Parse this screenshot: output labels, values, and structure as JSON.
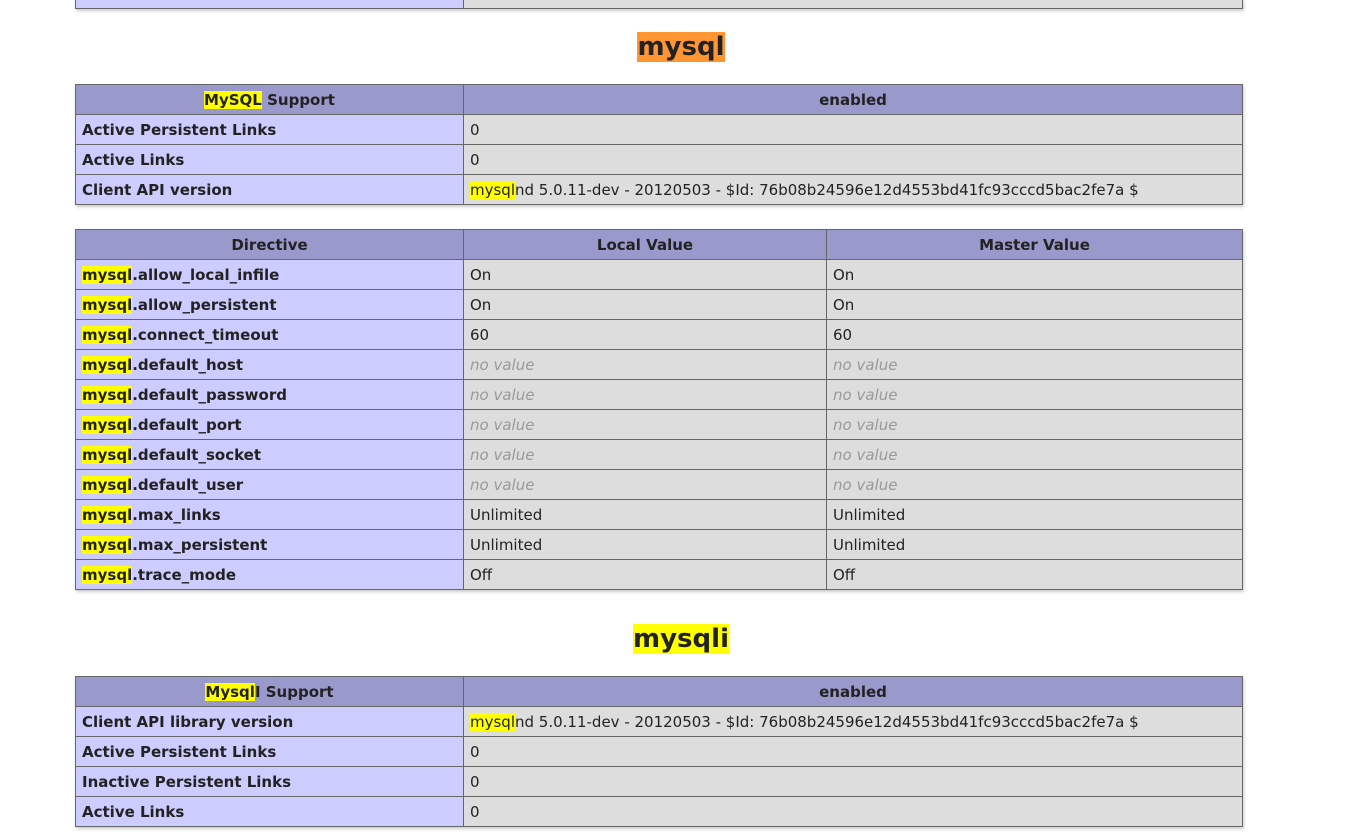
{
  "mysql": {
    "title": "mysql",
    "support": {
      "label_hl": "MySQL",
      "label_rest": " Support",
      "value": "enabled"
    },
    "rows": [
      {
        "label": "Active Persistent Links",
        "value": "0"
      },
      {
        "label": "Active Links",
        "value": "0"
      },
      {
        "label": "Client API version",
        "value_hl": "mysql",
        "value_rest": "nd 5.0.11-dev - 20120503 - $Id: 76b08b24596e12d4553bd41fc93cccd5bac2fe7a $"
      }
    ],
    "directives": {
      "headers": [
        "Directive",
        "Local Value",
        "Master Value"
      ],
      "prefix": "mysql",
      "rows": [
        {
          "name": ".allow_local_infile",
          "local": "On",
          "master": "On"
        },
        {
          "name": ".allow_persistent",
          "local": "On",
          "master": "On"
        },
        {
          "name": ".connect_timeout",
          "local": "60",
          "master": "60"
        },
        {
          "name": ".default_host",
          "local": "no value",
          "master": "no value"
        },
        {
          "name": ".default_password",
          "local": "no value",
          "master": "no value"
        },
        {
          "name": ".default_port",
          "local": "no value",
          "master": "no value"
        },
        {
          "name": ".default_socket",
          "local": "no value",
          "master": "no value"
        },
        {
          "name": ".default_user",
          "local": "no value",
          "master": "no value"
        },
        {
          "name": ".max_links",
          "local": "Unlimited",
          "master": "Unlimited"
        },
        {
          "name": ".max_persistent",
          "local": "Unlimited",
          "master": "Unlimited"
        },
        {
          "name": ".trace_mode",
          "local": "Off",
          "master": "Off"
        }
      ]
    }
  },
  "mysqli": {
    "title_hl": "mysql",
    "title_rest": "i",
    "support": {
      "label_hl": "Mysql",
      "label_rest": "I Support",
      "value": "enabled"
    },
    "rows": [
      {
        "label": "Client API library version",
        "value_hl": "mysql",
        "value_rest": "nd 5.0.11-dev - 20120503 - $Id: 76b08b24596e12d4553bd41fc93cccd5bac2fe7a $"
      },
      {
        "label": "Active Persistent Links",
        "value": "0"
      },
      {
        "label": "Inactive Persistent Links",
        "value": "0"
      },
      {
        "label": "Active Links",
        "value": "0"
      }
    ]
  },
  "colors": {
    "header_bg": "#9999cc",
    "label_bg": "#ccccff",
    "value_bg": "#dddddd",
    "search_highlight": "#ffff00",
    "current_match_highlight": "#ff9632"
  }
}
